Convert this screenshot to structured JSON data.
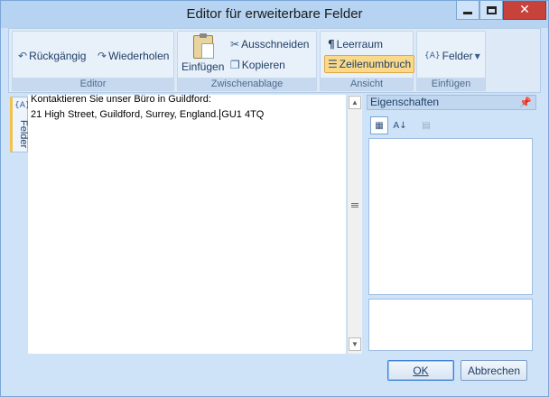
{
  "window": {
    "title": "Editor für erweiterbare Felder"
  },
  "ribbon": {
    "groups": {
      "editor": {
        "label": "Editor",
        "undo_label": "Rückgängig",
        "redo_label": "Wiederholen"
      },
      "clipboard": {
        "label": "Zwischenablage",
        "paste_label": "Einfügen",
        "cut_label": "Ausschneiden",
        "copy_label": "Kopieren"
      },
      "view": {
        "label": "Ansicht",
        "whitespace_label": "Leerraum",
        "wordwrap_label": "Zeilenumbruch"
      },
      "insert": {
        "label": "Einfügen",
        "fields_label": "Felder",
        "fields_badge": "{A}"
      }
    }
  },
  "sidetab": {
    "label": "Felder",
    "badge": "{A}"
  },
  "editor": {
    "line1": "Kontaktieren Sie unser Büro in Guildford:",
    "line2_before_caret": "21 High Street, Guildford, Surrey, England.",
    "line2_after_caret": "GU1 4TQ"
  },
  "properties": {
    "title": "Eigenschaften",
    "pin_icon": "pin-icon"
  },
  "footer": {
    "ok_label": "OK",
    "cancel_label": "Abbrechen"
  },
  "colors": {
    "accent": "#fbd98a",
    "titlebar": "#b6d3f1",
    "close": "#c7423b"
  }
}
